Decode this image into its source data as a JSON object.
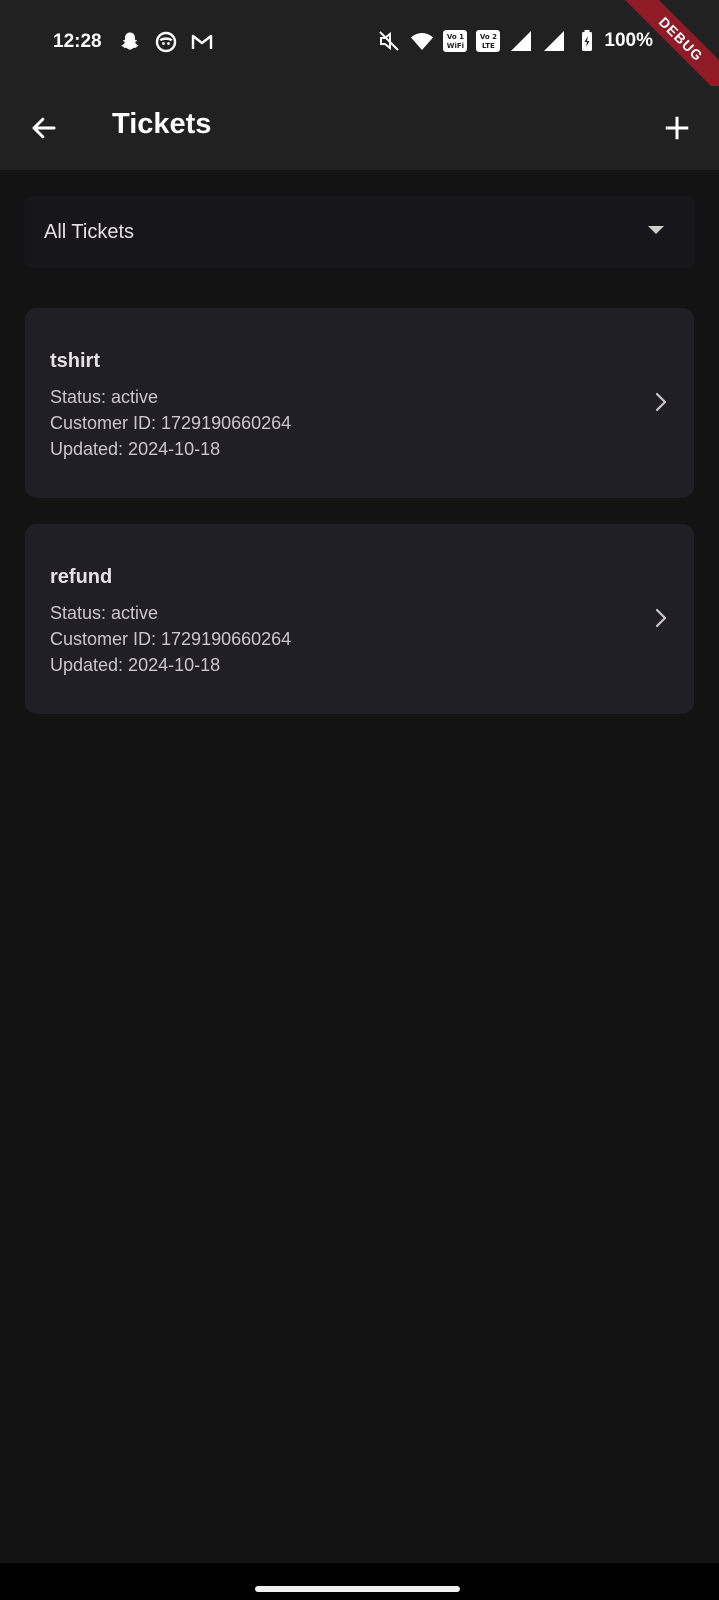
{
  "status_bar": {
    "time": "12:28",
    "left_icons": [
      "snapchat-icon",
      "messenger-icon",
      "gmail-icon"
    ],
    "right_icons": [
      "mute-icon",
      "wifi-icon",
      "volte-wifi-badge",
      "volte-lte-badge",
      "signal-icon",
      "signal-icon",
      "battery-charging-icon"
    ],
    "sim1_badge": "Vo 1\nWiFi",
    "sim2_badge": "Vo 2\nLTE",
    "battery": "100%"
  },
  "debug_banner": "DEBUG",
  "app_bar": {
    "title": "Tickets",
    "back_icon": "arrow-back-icon",
    "add_icon": "add-icon"
  },
  "filter": {
    "selected": "All Tickets"
  },
  "tickets": [
    {
      "name": "tshirt",
      "status": "Status: active",
      "customer": "Customer ID: 1729190660264",
      "updated": "Updated: 2024-10-18"
    },
    {
      "name": "refund",
      "status": "Status: active",
      "customer": "Customer ID: 1729190660264",
      "updated": "Updated: 2024-10-18"
    }
  ],
  "colors": {
    "background": "#131313",
    "app_bar": "#212121",
    "card": "#211f26",
    "debug": "#8e1b26"
  }
}
